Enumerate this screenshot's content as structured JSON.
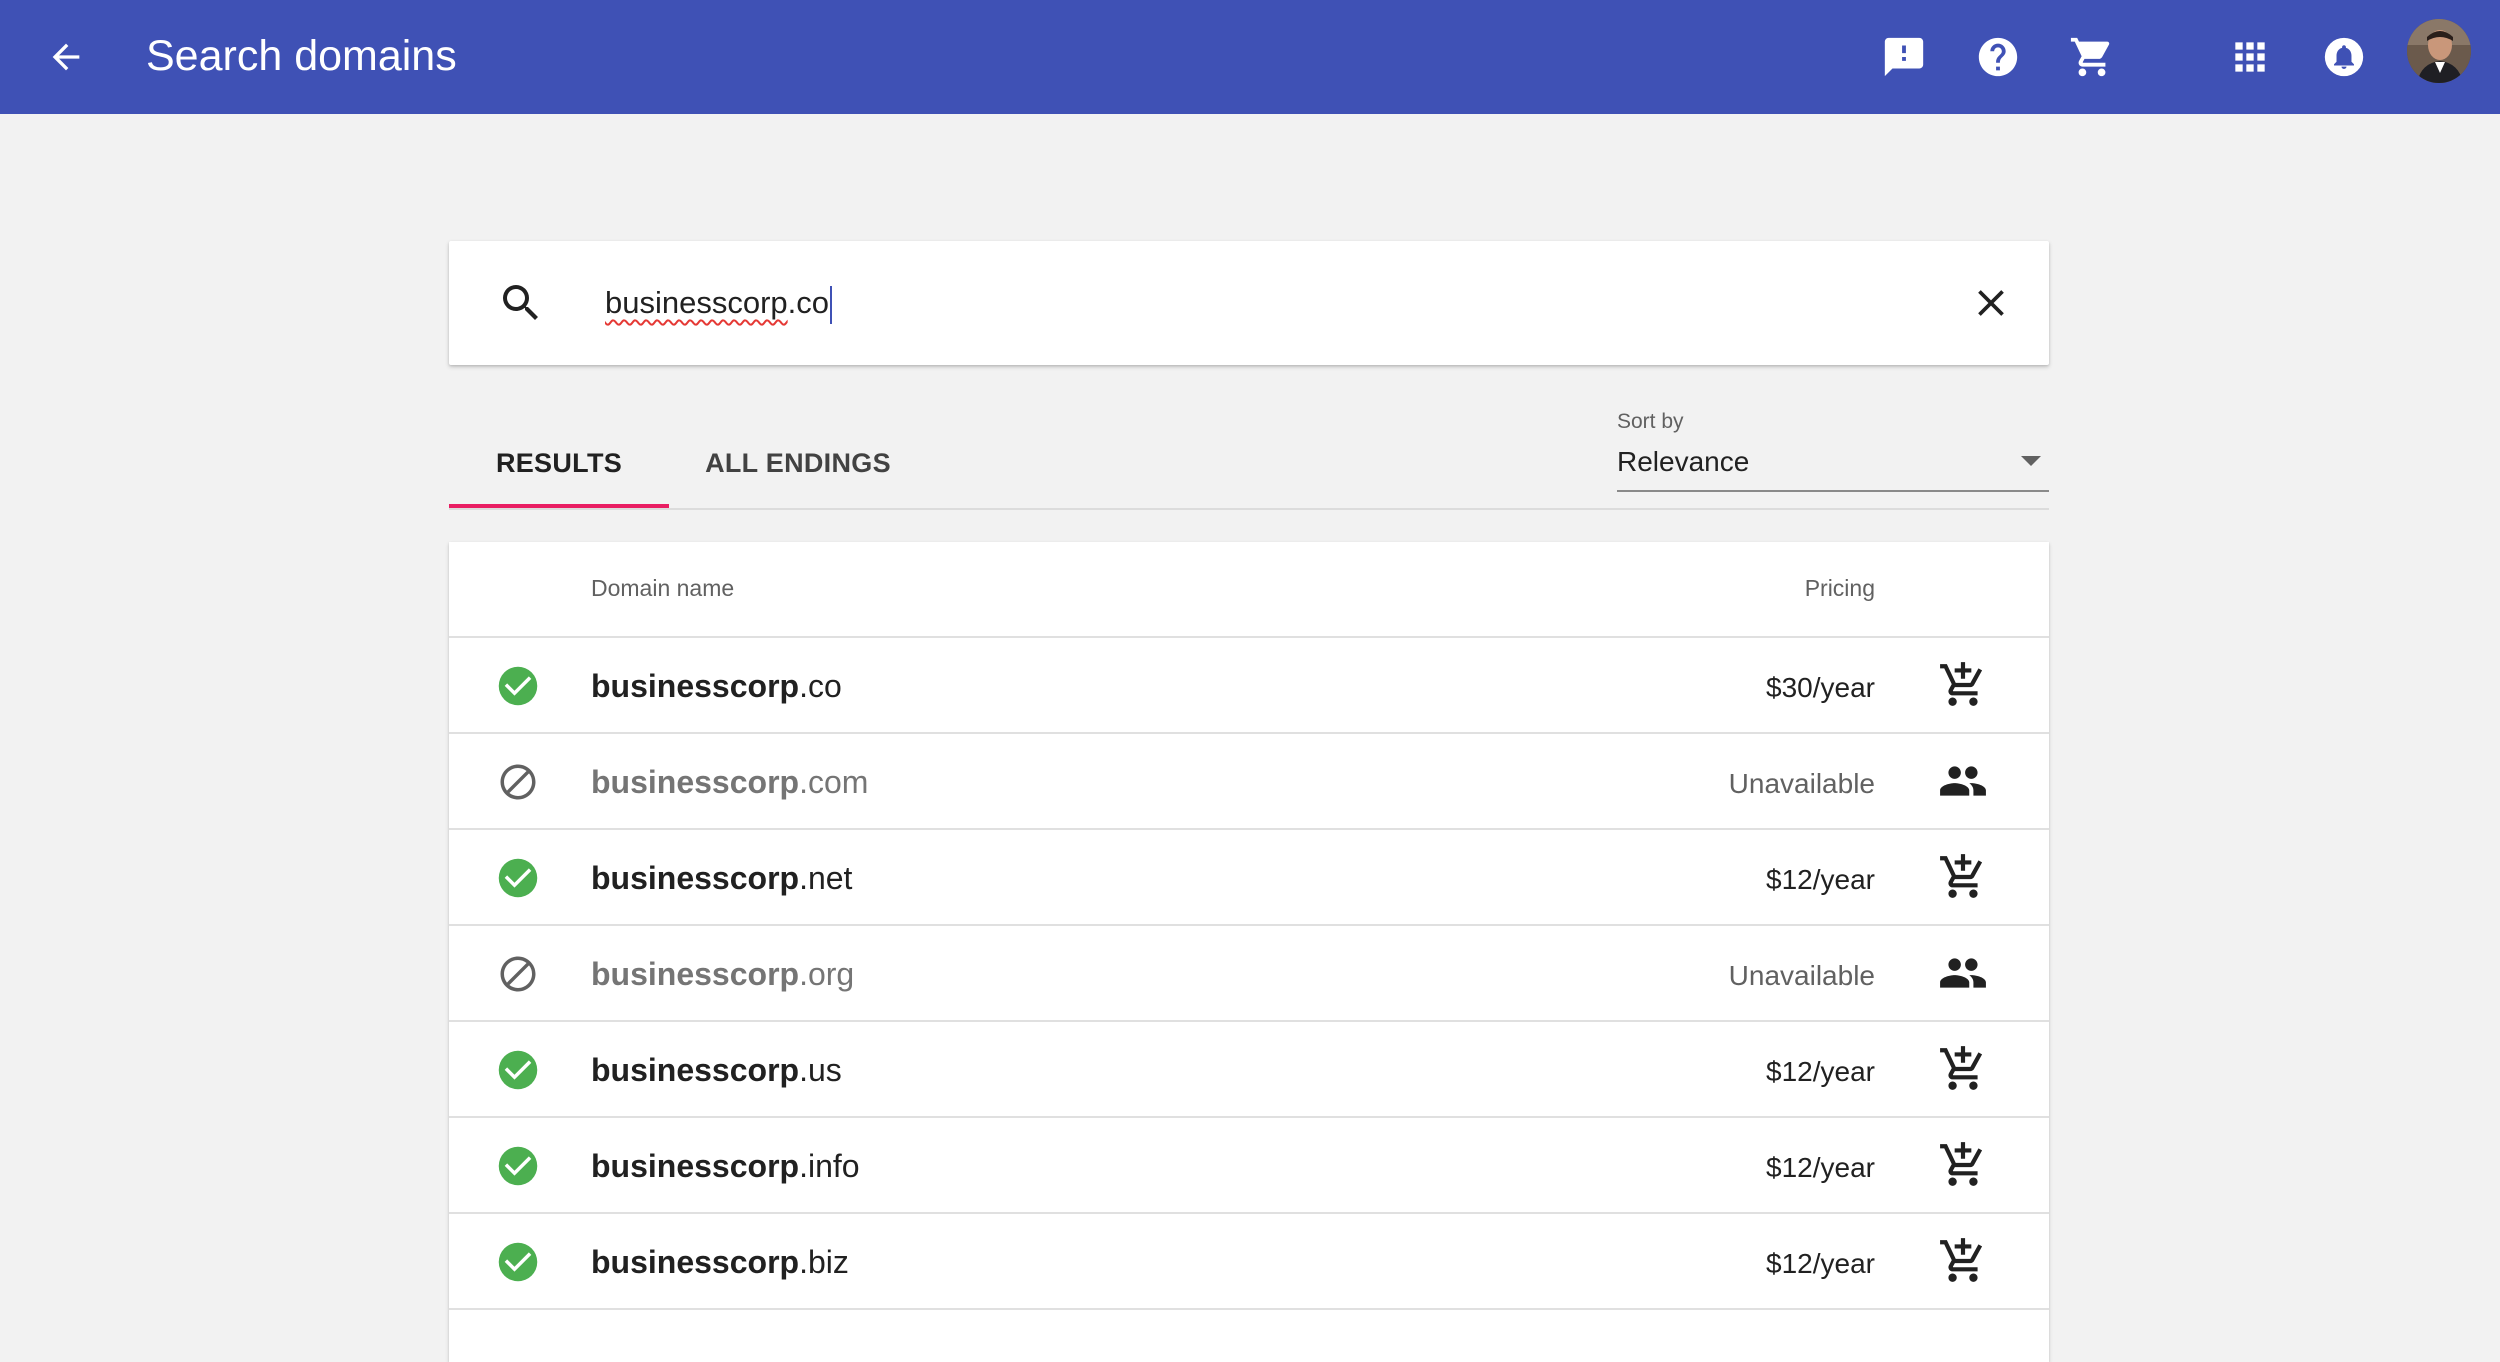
{
  "appbar": {
    "title": "Search domains",
    "color": "#3f51b5",
    "icons": [
      "arrow-back-icon",
      "feedback-icon",
      "help-icon",
      "cart-icon",
      "apps-grid-icon",
      "notifications-icon",
      "avatar"
    ]
  },
  "search": {
    "value_name": "businesscorp",
    "value_tld": ".co"
  },
  "tabs": [
    {
      "label": "RESULTS",
      "active": true
    },
    {
      "label": "ALL ENDINGS",
      "active": false
    }
  ],
  "sort": {
    "label": "Sort by",
    "value": "Relevance"
  },
  "table": {
    "headers": {
      "name": "Domain name",
      "pricing": "Pricing"
    },
    "rows": [
      {
        "name": "businesscorp",
        "tld": ".co",
        "status": "available",
        "price": "$30/year",
        "action": "add-to-cart-icon"
      },
      {
        "name": "businesscorp",
        "tld": ".com",
        "status": "unavailable",
        "price": "Unavailable",
        "action": "people-icon"
      },
      {
        "name": "businesscorp",
        "tld": ".net",
        "status": "available",
        "price": "$12/year",
        "action": "add-to-cart-icon"
      },
      {
        "name": "businesscorp",
        "tld": ".org",
        "status": "unavailable",
        "price": "Unavailable",
        "action": "people-icon"
      },
      {
        "name": "businesscorp",
        "tld": ".us",
        "status": "available",
        "price": "$12/year",
        "action": "add-to-cart-icon"
      },
      {
        "name": "businesscorp",
        "tld": ".info",
        "status": "available",
        "price": "$12/year",
        "action": "add-to-cart-icon"
      },
      {
        "name": "businesscorp",
        "tld": ".biz",
        "status": "available",
        "price": "$12/year",
        "action": "add-to-cart-icon"
      }
    ]
  },
  "colors": {
    "accent": "#e91e63",
    "available": "#4caf50",
    "unavailable": "#616161"
  }
}
